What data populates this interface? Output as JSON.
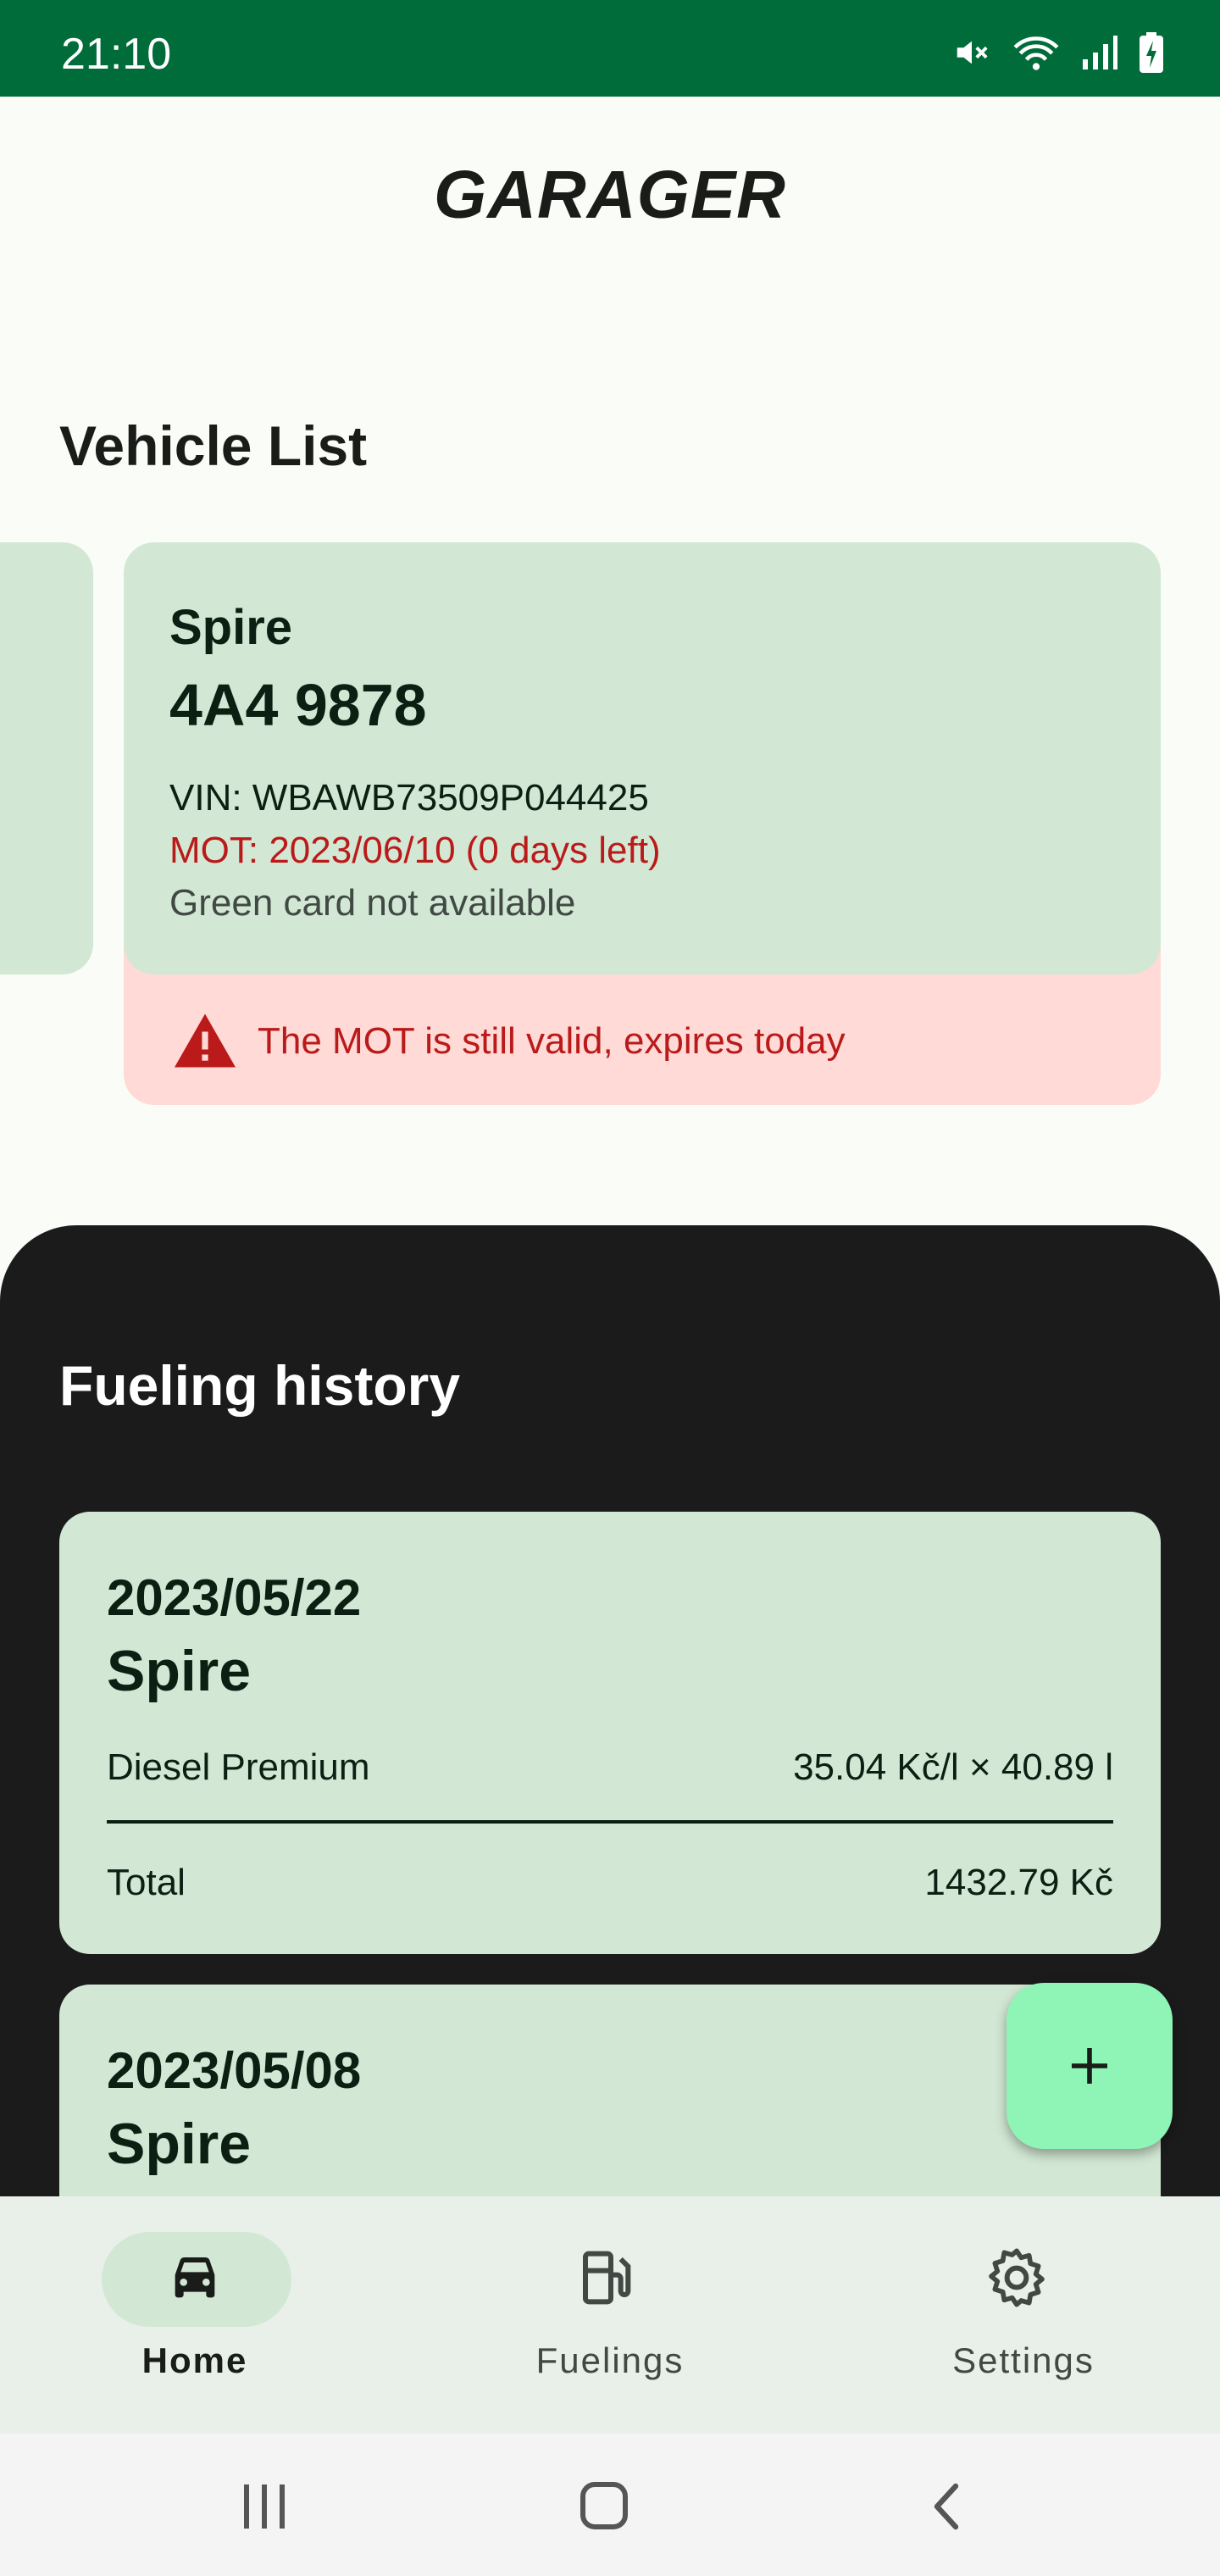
{
  "status_bar": {
    "time": "21:10",
    "icons": [
      "mute-icon",
      "wifi-icon",
      "signal-icon",
      "battery-charging-icon"
    ]
  },
  "app": {
    "title": "GARAGER"
  },
  "vehicle_list": {
    "title": "Vehicle List",
    "vehicle": {
      "name": "Spire",
      "plate": "4A4 9878",
      "vin": "VIN: WBAWB73509P044425",
      "mot": "MOT: 2023/06/10 (0 days left)",
      "green_card": "Green card not available",
      "warning": "The MOT is still valid, expires today",
      "warning_icon": "warning-icon"
    }
  },
  "fueling_history": {
    "title": "Fueling history",
    "entries": [
      {
        "date": "2023/05/22",
        "vehicle": "Spire",
        "fuel": "Diesel Premium",
        "price": "35.04 Kč/l × 40.89 l",
        "total_label": "Total",
        "total": "1432.79 Kč"
      },
      {
        "date": "2023/05/08",
        "vehicle": "Spire"
      }
    ]
  },
  "fab": {
    "icon": "plus-icon"
  },
  "bottom_nav": {
    "items": [
      {
        "label": "Home",
        "icon": "car-icon",
        "active": true
      },
      {
        "label": "Fuelings",
        "icon": "fuel-pump-icon",
        "active": false
      },
      {
        "label": "Settings",
        "icon": "gear-icon",
        "active": false
      }
    ]
  },
  "system_nav": {
    "icons": [
      "recent-apps-icon",
      "home-icon",
      "back-icon"
    ]
  },
  "colors": {
    "status_bar": "#006c3a",
    "card": "#d2e8d4",
    "warning_bg": "#ffdad6",
    "error": "#ba1a1a",
    "dark_section": "#1b1b1c",
    "fab": "#8ef5b6"
  }
}
